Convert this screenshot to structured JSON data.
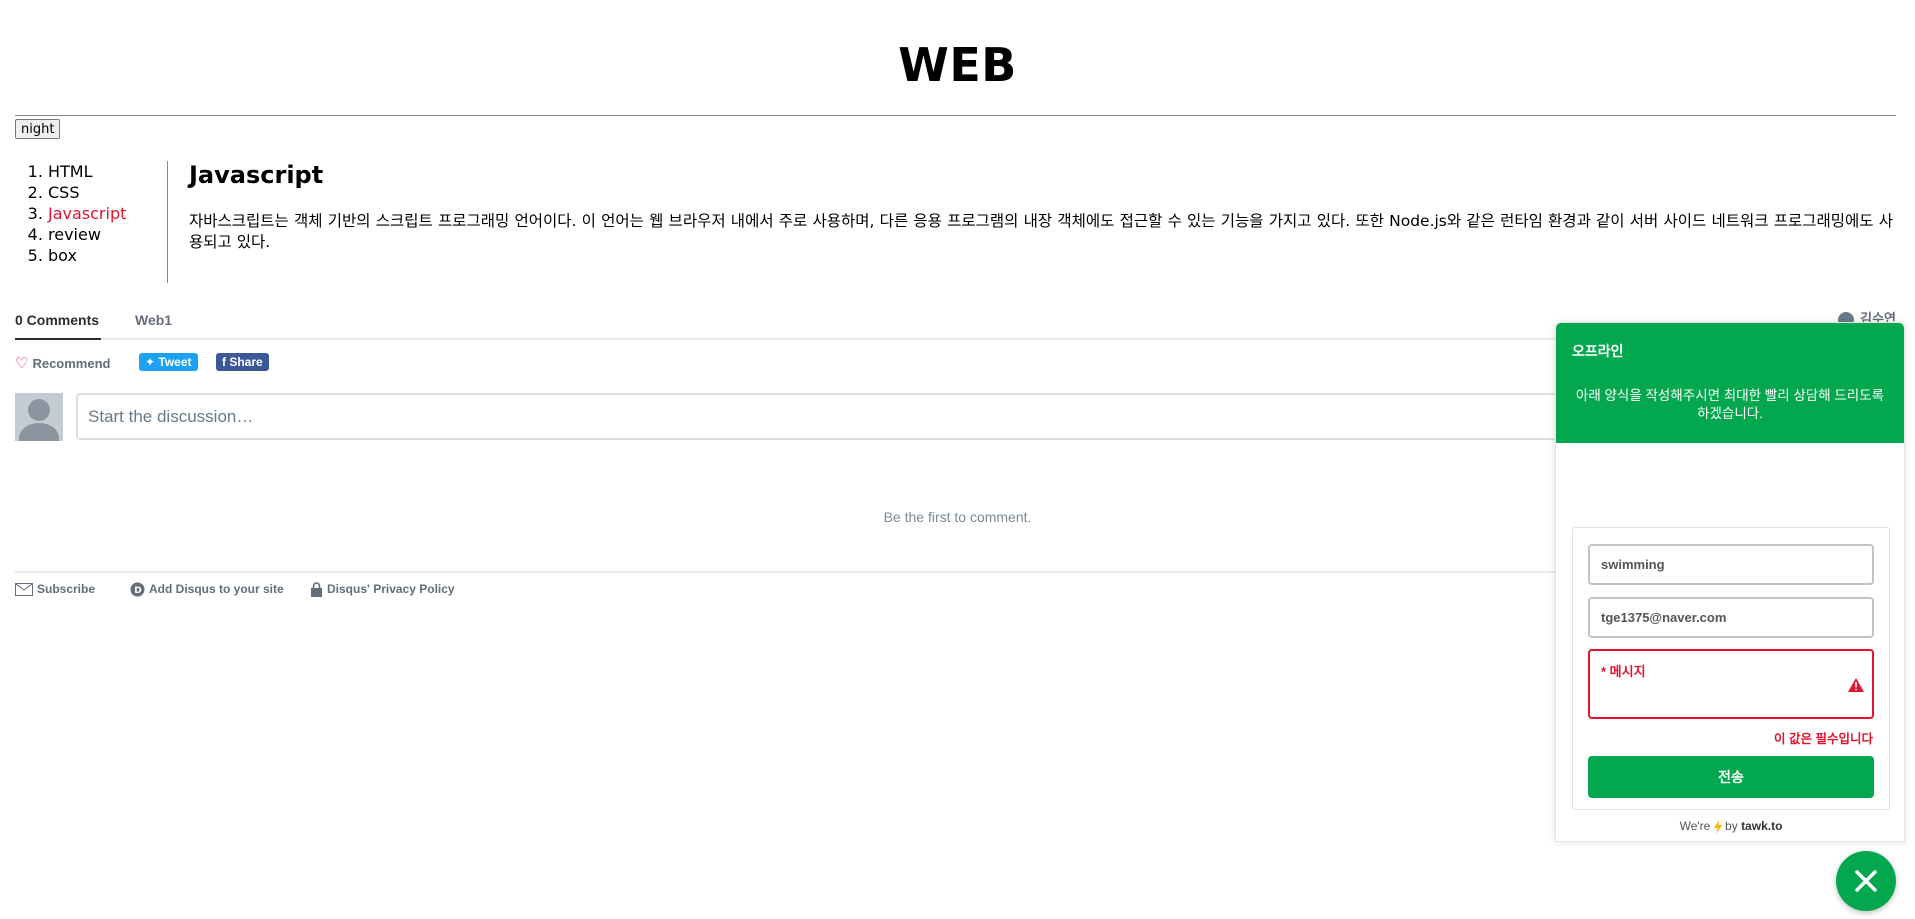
{
  "header": {
    "title": "WEB",
    "night_label": "night"
  },
  "toc": {
    "items": [
      {
        "label": "HTML"
      },
      {
        "label": "CSS"
      },
      {
        "label": "Javascript"
      },
      {
        "label": "review"
      },
      {
        "label": "box"
      }
    ]
  },
  "article": {
    "title": "Javascript",
    "body": "자바스크립트는 객체 기반의 스크립트 프로그래밍 언어이다. 이 언어는 웹 브라우저 내에서 주로 사용하며, 다른 응용 프로그램의 내장 객체에도 접근할 수 있는 기능을 가지고 있다. 또한 Node.js와 같은 런타임 환경과 같이 서버 사이드 네트워크 프로그래밍에도 사용되고 있다."
  },
  "disqus": {
    "tab_comments": "0 Comments",
    "tab_site": "Web1",
    "user_name": "김수연",
    "recommend": "Recommend",
    "tweet": "Tweet",
    "share": "Share",
    "composer_placeholder": "Start the discussion…",
    "empty": "Be the first to comment.",
    "footer": {
      "subscribe": "Subscribe",
      "add": "Add Disqus to your site",
      "privacy": "Disqus' Privacy Policy"
    }
  },
  "tawk": {
    "status": "오프라인",
    "description": "아래 양식을 작성해주시면 최대한 빨리 상담해 드리도록 하겠습니다.",
    "name_value": "swimming",
    "email_value": "tge1375@naver.com",
    "message_label": "* 메시지",
    "error": "이 값은 필수입니다",
    "send": "전송",
    "powered_prefix": "We're",
    "powered_by": "by",
    "brand": "tawk.to"
  },
  "colors": {
    "tawk_green": "#03a84e",
    "error_red": "#e0142e",
    "active_link": "#e0142e"
  }
}
